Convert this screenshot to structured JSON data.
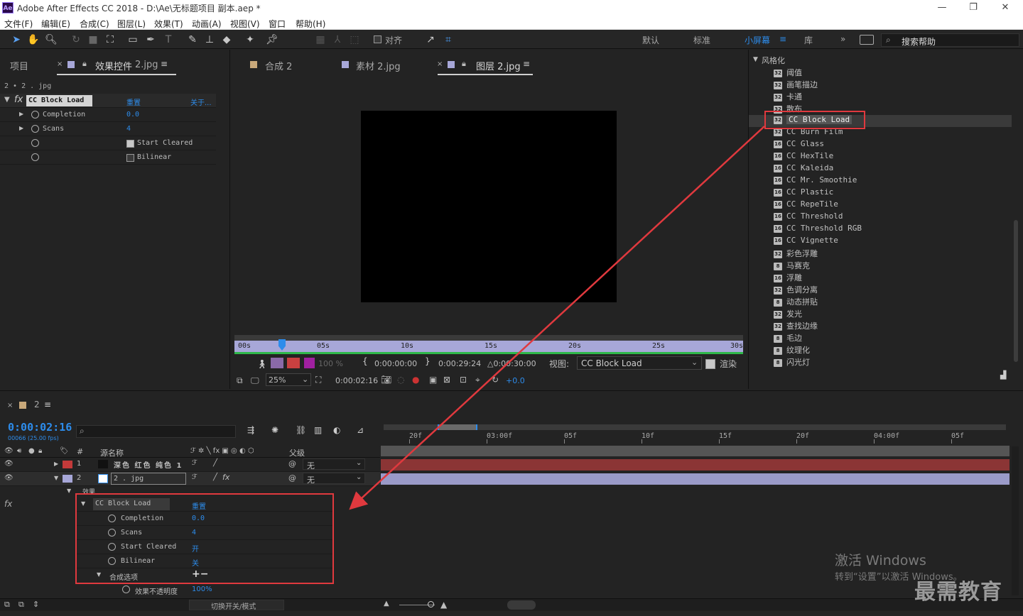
{
  "window": {
    "title": "Adobe After Effects CC 2018 - D:\\Ae\\无标题项目 副本.aep *",
    "logo": "Ae"
  },
  "menu": [
    "文件(F)",
    "编辑(E)",
    "合成(C)",
    "图层(L)",
    "效果(T)",
    "动画(A)",
    "视图(V)",
    "窗口",
    "帮助(H)"
  ],
  "toolbar": {
    "align_label": "对齐",
    "workspaces": [
      "默认",
      "标准",
      "小屏幕",
      "库"
    ],
    "active_workspace": "小屏幕",
    "search_placeholder": "搜索帮助"
  },
  "effect_controls": {
    "tab_project": "项目",
    "tab_effects": "效果控件",
    "tab_effects_target": "2.jpg",
    "breadcrumb": "2 • 2 . jpg",
    "effect_name": "CC Block Load",
    "reset": "重置",
    "about": "关于...",
    "props": [
      {
        "name": "Completion",
        "value": "0.0"
      },
      {
        "name": "Scans",
        "value": "4"
      },
      {
        "name": "Start Cleared",
        "value": "",
        "checked": true
      },
      {
        "name": "Bilinear",
        "value": "",
        "checked": false
      }
    ]
  },
  "viewer": {
    "tabs": [
      "合成 2",
      "素材 2.jpg",
      "图层 2.jpg"
    ],
    "active_tab": "图层 2.jpg",
    "ruler_labels": [
      "00s",
      "05s",
      "10s",
      "15s",
      "20s",
      "25s",
      "30s"
    ],
    "opacity": "100 %",
    "time_in": "0:00:00:00",
    "time_out": "0:00:29:24",
    "duration": "△0:00:30:00",
    "view_label": "视图:",
    "view_value": "CC Block Load",
    "render_label": "渲染",
    "zoom": "25%",
    "current_time": "0:00:02:16",
    "exposure": "+0.0"
  },
  "effects_panel": {
    "group": "风格化",
    "items": [
      {
        "badge": "32",
        "name": "阈值"
      },
      {
        "badge": "32",
        "name": "画笔描边"
      },
      {
        "badge": "32",
        "name": "卡通"
      },
      {
        "badge": "32",
        "name": "散布"
      },
      {
        "badge": "32",
        "name": "CC Block Load",
        "selected": true
      },
      {
        "badge": "32",
        "name": "CC Burn Film"
      },
      {
        "badge": "16",
        "name": "CC Glass"
      },
      {
        "badge": "16",
        "name": "CC HexTile"
      },
      {
        "badge": "16",
        "name": "CC Kaleida"
      },
      {
        "badge": "16",
        "name": "CC Mr. Smoothie"
      },
      {
        "badge": "16",
        "name": "CC Plastic"
      },
      {
        "badge": "16",
        "name": "CC RepeTile"
      },
      {
        "badge": "16",
        "name": "CC Threshold"
      },
      {
        "badge": "16",
        "name": "CC Threshold RGB"
      },
      {
        "badge": "16",
        "name": "CC Vignette"
      },
      {
        "badge": "32",
        "name": "彩色浮雕"
      },
      {
        "badge": "8",
        "name": "马赛克"
      },
      {
        "badge": "16",
        "name": "浮雕"
      },
      {
        "badge": "32",
        "name": "色调分离"
      },
      {
        "badge": "8",
        "name": "动态拼贴"
      },
      {
        "badge": "32",
        "name": "发光"
      },
      {
        "badge": "32",
        "name": "查找边缘"
      },
      {
        "badge": "8",
        "name": "毛边"
      },
      {
        "badge": "8",
        "name": "纹理化"
      },
      {
        "badge": "8",
        "name": "闪光灯"
      }
    ]
  },
  "timeline": {
    "comp_name": "2",
    "timecode": "0:00:02:16",
    "frame_info": "00066 (25.00 fps)",
    "col_num": "#",
    "col_source": "源名称",
    "col_parent": "父级",
    "ruler_labels": [
      "20f",
      "03:00f",
      "05f",
      "10f",
      "15f",
      "20f",
      "04:00f",
      "05f"
    ],
    "layers": [
      {
        "num": "1",
        "name": "深色 红色 纯色 1",
        "parent": "无",
        "color": "#c33a3a"
      },
      {
        "num": "2",
        "name": "2 . jpg",
        "parent": "无",
        "color": "#a7a7d8"
      }
    ],
    "effects_label": "效果",
    "effect_name": "CC Block Load",
    "reset": "重置",
    "props": [
      {
        "name": "Completion",
        "value": "0.0"
      },
      {
        "name": "Scans",
        "value": "4"
      },
      {
        "name": "Start Cleared",
        "value": "开"
      },
      {
        "name": "Bilinear",
        "value": "关"
      }
    ],
    "composite_label": "合成选项",
    "composite_value": "+−",
    "opacity_label": "效果不透明度",
    "opacity_value": "100%",
    "toggle_label": "切换开关/模式"
  },
  "watermark": {
    "line1": "激活 Windows",
    "line2": "转到“设置”以激活 Windows。",
    "brand": "最需教育"
  },
  "colors": {
    "accent": "#2d8ceb",
    "highlight": "#e0393e",
    "layer1": "#c33a3a",
    "layer2": "#a7a7d8"
  }
}
